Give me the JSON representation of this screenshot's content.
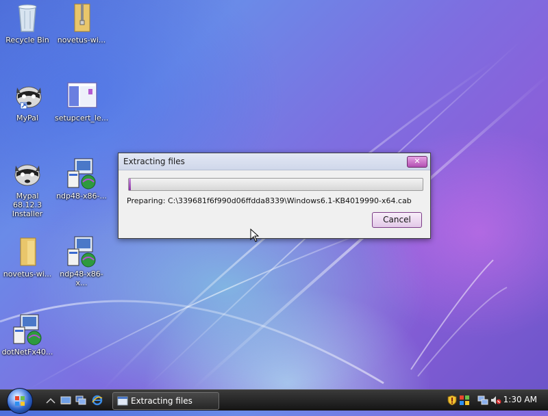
{
  "desktop": {
    "icons": [
      {
        "label": "Recycle Bin",
        "icon": "recycle-bin-icon"
      },
      {
        "label": "novetus-wi...",
        "icon": "zip-folder-icon"
      },
      {
        "label": "MyPal",
        "icon": "raccoon-icon"
      },
      {
        "label": "setupcert_le...",
        "icon": "window-app-icon"
      },
      {
        "label": "Mypal 68.12.3 Installer",
        "icon": "raccoon-icon"
      },
      {
        "label": "ndp48-x86-...",
        "icon": "installer-icon"
      },
      {
        "label": "novetus-wi...",
        "icon": "folder-icon"
      },
      {
        "label": "ndp48-x86-x...",
        "icon": "installer-icon"
      },
      {
        "label": "dotNetFx40...",
        "icon": "installer-icon"
      }
    ]
  },
  "dialog": {
    "title": "Extracting files",
    "close_glyph": "✕",
    "progress": 0.008,
    "status": "Preparing: C:\\339681f6f990d06ffdda8339\\Windows6.1-KB4019990-x64.cab",
    "cancel_label": "Cancel"
  },
  "taskbar": {
    "task_label": "Extracting files",
    "clock": "1:30 AM"
  },
  "colors": {
    "accent": "#8a2fa6",
    "taskbar": "#1e1e1e"
  }
}
